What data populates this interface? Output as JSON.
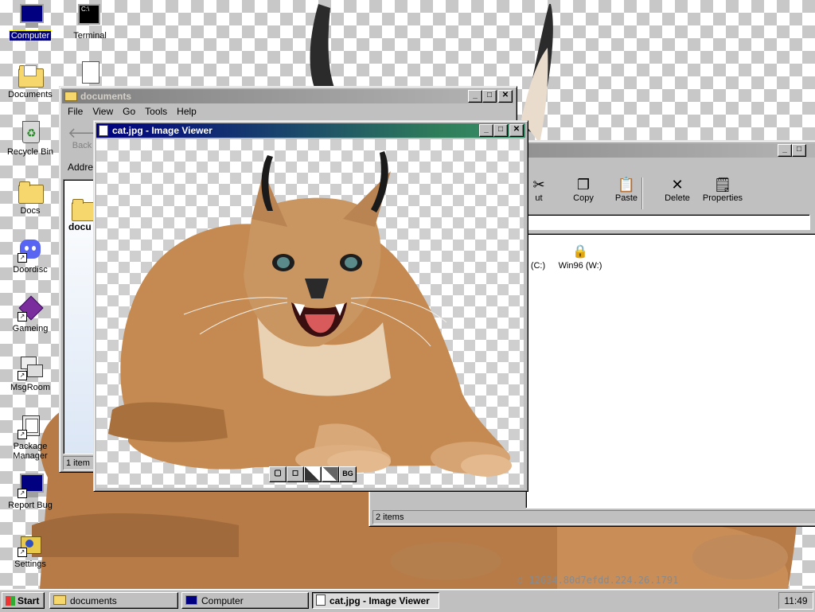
{
  "desktop": {
    "icons": [
      {
        "label": "Computer",
        "icon": "computer-icon"
      },
      {
        "label": "Terminal",
        "icon": "terminal-icon"
      },
      {
        "label": "Documents",
        "icon": "documents-icon"
      },
      {
        "label": "Recycle Bin",
        "icon": "recycle-bin-icon"
      },
      {
        "label": "Docs",
        "icon": "folder-icon"
      },
      {
        "label": "Doordisc",
        "icon": "doordisc-icon"
      },
      {
        "label": "Gameing",
        "icon": "cube-icon"
      },
      {
        "label": "MsgRoom",
        "icon": "msgroom-icon"
      },
      {
        "label": "Package Manager",
        "icon": "package-icon"
      },
      {
        "label": "Report Bug",
        "icon": "bug-report-icon"
      },
      {
        "label": "Settings",
        "icon": "settings-icon"
      }
    ],
    "watermark": "d 12634.80d7efdd.224.26.1791"
  },
  "documents_window": {
    "title": "documents",
    "menu": [
      "File",
      "View",
      "Go",
      "Tools",
      "Help"
    ],
    "back_label": "Back",
    "address_label": "Addres",
    "item_label": "docu",
    "status": "1 item"
  },
  "computer_window": {
    "toolbar": [
      "ut",
      "Copy",
      "Paste",
      "Delete",
      "Properties"
    ],
    "drives": [
      {
        "label": "(C:)"
      },
      {
        "label": "Win96 (W:)"
      }
    ],
    "status": "2 items"
  },
  "viewer_window": {
    "title": "cat.jpg - Image Viewer",
    "controls": [
      "fit-icon",
      "original-size-icon",
      "checker-dark-icon",
      "checker-light-icon",
      "BG"
    ]
  },
  "taskbar": {
    "start": "Start",
    "tasks": [
      {
        "label": "documents",
        "active": false
      },
      {
        "label": "Computer",
        "active": false
      },
      {
        "label": "cat.jpg - Image Viewer",
        "active": true
      }
    ],
    "clock": "11:49"
  }
}
